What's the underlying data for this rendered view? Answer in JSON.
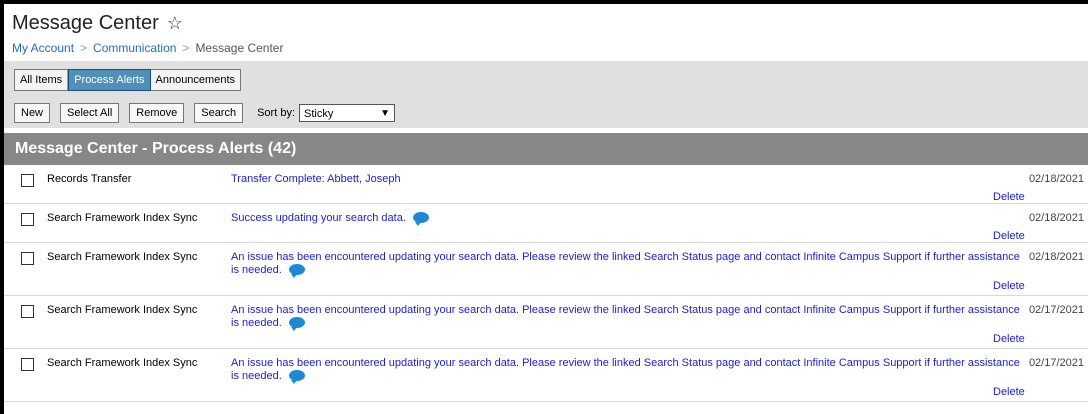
{
  "header": {
    "title": "Message Center",
    "star_icon": "☆",
    "breadcrumb": [
      "My Account",
      "Communication",
      "Message Center"
    ],
    "breadcrumb_sep": ">"
  },
  "tabs": [
    {
      "label": "All Items",
      "active": false
    },
    {
      "label": "Process Alerts",
      "active": true
    },
    {
      "label": "Announcements",
      "active": false
    }
  ],
  "actions": {
    "new_label": "New",
    "select_all_label": "Select All",
    "remove_label": "Remove",
    "search_label": "Search",
    "sort_label": "Sort by:",
    "sort_value": "Sticky"
  },
  "section": {
    "title": "Message Center - Process Alerts (42)"
  },
  "messages": [
    {
      "source": "Records Transfer",
      "text": "Transfer Complete: Abbett, Joseph",
      "has_comment": false,
      "date": "02/18/2021",
      "delete_label": "Delete"
    },
    {
      "source": "Search Framework Index Sync",
      "text": "Success updating your search data.",
      "has_comment": true,
      "date": "02/18/2021",
      "delete_label": "Delete"
    },
    {
      "source": "Search Framework Index Sync",
      "text": "An issue has been encountered updating your search data. Please review the linked Search Status page and contact Infinite Campus Support if further assistance is needed.",
      "has_comment": true,
      "date": "02/18/2021",
      "delete_label": "Delete"
    },
    {
      "source": "Search Framework Index Sync",
      "text": "An issue has been encountered updating your search data. Please review the linked Search Status page and contact Infinite Campus Support if further assistance is needed.",
      "has_comment": true,
      "date": "02/17/2021",
      "delete_label": "Delete"
    },
    {
      "source": "Search Framework Index Sync",
      "text": "An issue has been encountered updating your search data. Please review the linked Search Status page and contact Infinite Campus Support if further assistance is needed.",
      "has_comment": true,
      "date": "02/17/2021",
      "delete_label": "Delete"
    }
  ],
  "colors": {
    "tab_active": "#4f8fba",
    "section_band": "#878787",
    "link": "#1c1cd6",
    "comment_bubble": "#1e88d6"
  }
}
